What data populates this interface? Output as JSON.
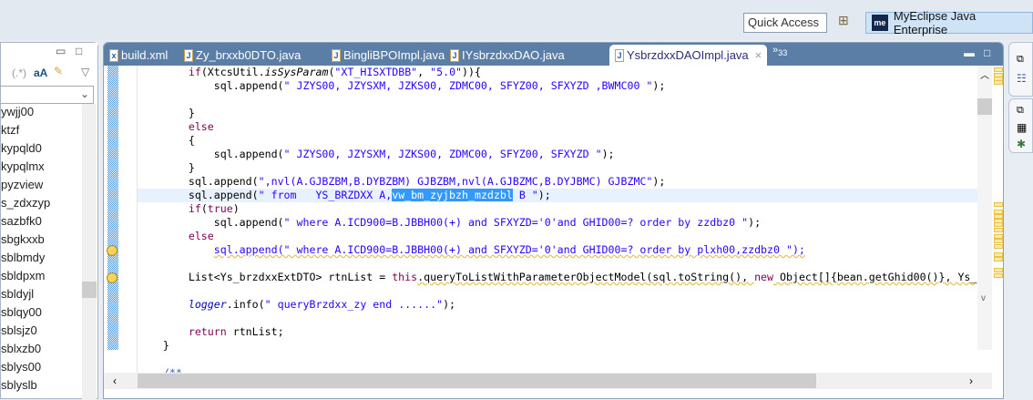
{
  "toolbar": {
    "quick_access_placeholder": "Quick Access",
    "perspective_logo": "me",
    "perspective_label": "MyEclipse Java Enterprise"
  },
  "left_panel": {
    "tool_regex": "(.*)",
    "tool_case": "aA",
    "items": [
      "ywjj00",
      "ktzf",
      "kypqld0",
      "kypqlmx",
      "pyzview",
      "s_zdxzyp",
      "sazbfk0",
      "sbgkxxb",
      "sblbmdy",
      "sbldpxm",
      "sbldyjl",
      "sblqy00",
      "sblsjz0",
      "sblxzb0",
      "sblys00",
      "sblyslb"
    ]
  },
  "editor": {
    "tabs": [
      {
        "label": "build.xml",
        "icon": "xml-file-icon"
      },
      {
        "label": "Zy_brxxb0DTO.java",
        "icon": "java-file-icon"
      },
      {
        "label": "BingliBPOImpl.java",
        "icon": "java-file-icon"
      },
      {
        "label": "IYsbrzdxxDAO.java",
        "icon": "java-file-icon"
      },
      {
        "label": "YsbrzdxxDAOImpl.java",
        "icon": "java-file-icon",
        "active": true
      }
    ],
    "overflow_count": "33",
    "current_line": 9,
    "lines": [
      [
        [
          "        ",
          ""
        ],
        [
          "if",
          "kw"
        ],
        [
          "(XtcsUtil.",
          ""
        ],
        [
          "isSysParam",
          "it"
        ],
        [
          "(",
          ""
        ],
        [
          "\"XT_HISXTDBB\"",
          "str"
        ],
        [
          ", ",
          ""
        ],
        [
          "\"5.0\"",
          "str"
        ],
        [
          ")){",
          ""
        ]
      ],
      [
        [
          "            sql.append(",
          ""
        ],
        [
          "\" JZYS00, JZYSXM, JZKS00, ZDMC00, SFYZ00, SFXYZD ,BWMC00 \"",
          "str"
        ],
        [
          ");",
          ""
        ]
      ],
      [],
      [
        [
          "        }",
          ""
        ]
      ],
      [
        [
          "        ",
          ""
        ],
        [
          "else",
          "kw"
        ]
      ],
      [
        [
          "        {",
          ""
        ]
      ],
      [
        [
          "            sql.append(",
          ""
        ],
        [
          "\" JZYS00, JZYSXM, JZKS00, ZDMC00, SFYZ00, SFXYZD \"",
          "str"
        ],
        [
          ");",
          ""
        ]
      ],
      [
        [
          "        }",
          ""
        ]
      ],
      [
        [
          "        sql.append(",
          ""
        ],
        [
          "\",nvl(A.GJBZBM,B.DYBZBM) GJBZBM,nvl(A.GJBZMC,B.DYJBMC) GJBZMC\"",
          "str"
        ],
        [
          ");",
          ""
        ]
      ],
      [
        [
          "        sql.append(",
          ""
        ],
        [
          "\" from   YS_BRZDXX A,",
          "str"
        ],
        [
          "vw_bm_zyjbzh_mzdzbl",
          "sel"
        ],
        [
          " B \"",
          "str"
        ],
        [
          ");",
          ""
        ]
      ],
      [
        [
          "        ",
          ""
        ],
        [
          "if",
          "kw"
        ],
        [
          "(",
          ""
        ],
        [
          "true",
          "kw"
        ],
        [
          ")",
          ""
        ]
      ],
      [
        [
          "            sql.append(",
          ""
        ],
        [
          "\" where A.ICD900=B.JBBH00(+) and SFXYZD='0'and GHID00=? order by zzdbz0 \"",
          "str"
        ],
        [
          ");",
          ""
        ]
      ],
      [
        [
          "        ",
          ""
        ],
        [
          "else",
          "kw"
        ]
      ],
      [
        [
          "            ",
          ""
        ],
        [
          "sql.append(\" where A.ICD900=B.JBBH00(+) and SFXYZD='0'and GHID00=? order by plxh00,zzdbz0 \");",
          "warnstr"
        ]
      ],
      [],
      [
        [
          "        List<Ys_brzdxxExtDTO> rtnList = ",
          ""
        ],
        [
          "this",
          "kw"
        ],
        [
          ".queryToListWithParameterObjectModel(sql.toString(), ",
          "warn"
        ],
        [
          "new",
          "kw"
        ],
        [
          " Object[]{bean.getGhid00()}, Ys_",
          "warn"
        ]
      ],
      [],
      [
        [
          "        ",
          ""
        ],
        [
          "logger",
          "itb"
        ],
        [
          ".info(",
          ""
        ],
        [
          "\" queryBrzdxx_zy end ......\"",
          "str"
        ],
        [
          ");",
          ""
        ]
      ],
      [],
      [
        [
          "        ",
          ""
        ],
        [
          "return",
          "kw"
        ],
        [
          " rtnList;",
          ""
        ]
      ],
      [
        [
          "    }",
          ""
        ]
      ],
      [],
      [
        [
          "    ",
          ""
        ],
        [
          "/**",
          "com"
        ]
      ]
    ]
  }
}
